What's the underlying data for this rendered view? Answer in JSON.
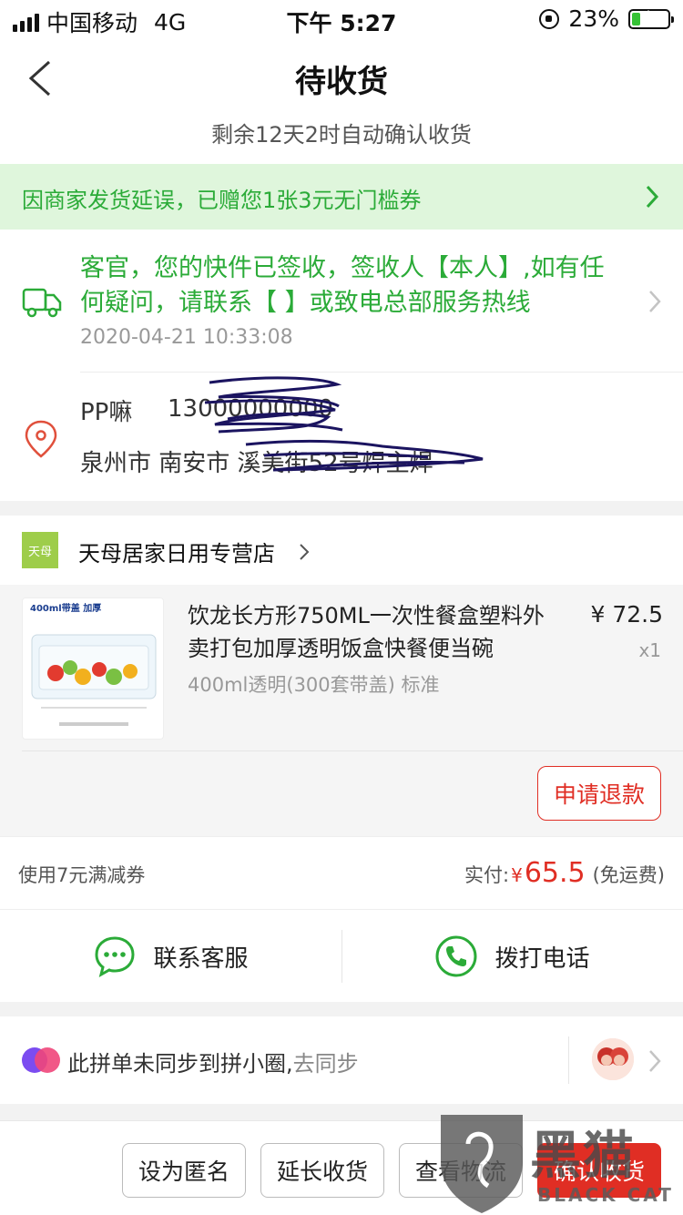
{
  "status_bar": {
    "carrier": "中国移动",
    "network": "4G",
    "time": "下午 5:27",
    "battery_text": "23%",
    "battery_level": 0.23
  },
  "header": {
    "title": "待收货",
    "subtitle": "剩余12天2时自动确认收货"
  },
  "banner": {
    "text": "因商家发货延误，已赠您1张3元无门槛券"
  },
  "delivery": {
    "message": "客官，您的快件已签收，签收人【本人】,如有任何疑问，请联系【 】或致电总部服务热线",
    "timestamp": "2020-04-21 10:33:08"
  },
  "address": {
    "name": "PP嘛",
    "phone": "13000000000",
    "line": "泉州市 南安市 溪美街52号焊主焊"
  },
  "shop": {
    "logo_text": "天母",
    "name": "天母居家日用专营店"
  },
  "item": {
    "title": "饮龙长方形750ML一次性餐盒塑料外卖打包加厚透明饭盒快餐便当碗",
    "spec": "400ml透明(300套带盖) 标准",
    "price": "¥ 72.5",
    "qty": "x1",
    "thumb_label": "400ml带盖 加厚",
    "refund_label": "申请退款"
  },
  "payment": {
    "coupon": "使用7元满减券",
    "paid_label": "实付:",
    "currency": "¥",
    "amount": "65.5",
    "shipping": "(免运费)"
  },
  "contact": {
    "service_label": "联系客服",
    "call_label": "拨打电话"
  },
  "pin": {
    "text": "此拼单未同步到拼小圈,",
    "link": "去同步"
  },
  "actions": {
    "anonymous": "设为匿名",
    "extend": "延长收货",
    "logistics": "查看物流",
    "confirm": "确认收货"
  },
  "watermark": {
    "cn": "黑猫",
    "en": "BLACK CAT"
  },
  "colors": {
    "green": "#2bab38",
    "red": "#e02e24",
    "banner_bg": "#dff6dc"
  },
  "icons": [
    "signal-icon",
    "lock-icon",
    "battery-icon",
    "back-icon",
    "chevron-right-icon",
    "truck-icon",
    "location-pin-icon",
    "chat-icon",
    "phone-icon",
    "avatar"
  ]
}
